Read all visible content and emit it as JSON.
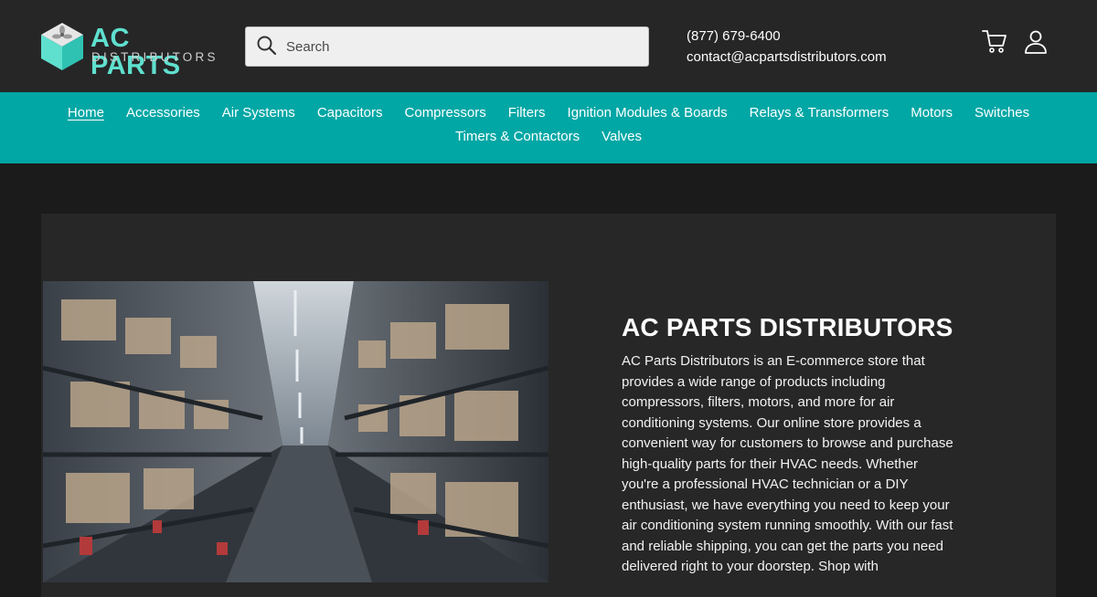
{
  "header": {
    "logo": {
      "word1": "AC PARTS",
      "word2": "DISTRIBUTORS"
    },
    "search": {
      "placeholder": "Search"
    },
    "contact": {
      "phone": "(877) 679-6400",
      "email": "contact@acpartsdistributors.com"
    },
    "icons": {
      "search": "search-icon",
      "cart": "cart-icon",
      "account": "account-icon"
    }
  },
  "nav": {
    "row1": [
      "Home",
      "Accessories",
      "Air Systems",
      "Capacitors",
      "Compressors",
      "Filters",
      "Ignition Modules & Boards",
      "Relays & Transformers",
      "Motors",
      "Switches"
    ],
    "row2": [
      "Timers & Contactors",
      "Valves"
    ],
    "active": "Home"
  },
  "about": {
    "title": "AC PARTS DISTRIBUTORS",
    "body": "AC Parts Distributors is an E-commerce store that provides a wide range of products including compressors, filters, motors, and more for air conditioning systems. Our online store provides a convenient way for customers to browse and purchase high-quality parts for their HVAC needs. Whether you're a professional HVAC technician or a DIY enthusiast, we have everything you need to keep your air conditioning system running smoothly. With our fast and reliable shipping, you can get the parts you need delivered right to your doorstep. Shop with"
  },
  "colors": {
    "topbar": "#262627",
    "nav": "#00a7a5",
    "accent": "#5fe0cf",
    "page": "#1b1b1c",
    "panel": "#272728"
  }
}
